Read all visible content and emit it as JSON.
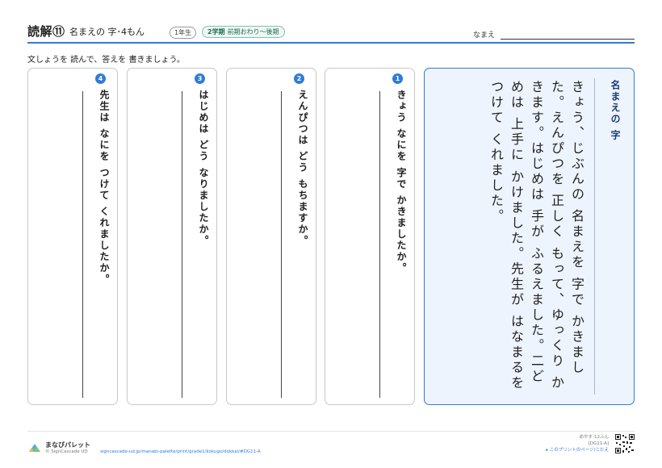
{
  "header": {
    "title": "読解⑪",
    "subtitle": "名まえの 字･4もん",
    "grade_badge": "1年生",
    "term_main": "2学期",
    "term_detail": "前期おわり〜後期",
    "name_label": "なまえ"
  },
  "instruction": "文しょうを 読んで、答えを 書きましょう。",
  "story": {
    "title": "名まえの 字",
    "body": "きょう、じぶんの 名まえを 字で かきました。えんぴつを 正しく もって、ゆっくり かきます。はじめは 手が ふるえました。二どめは 上手に かけました。先生が はなまるを つけて くれました。"
  },
  "questions": [
    {
      "number": "1",
      "text": "きょう なにを 字で かきましたか。"
    },
    {
      "number": "2",
      "text": "えんぴつは どう もちますか。"
    },
    {
      "number": "3",
      "text": "はじめは どう なりましたか。"
    },
    {
      "number": "4",
      "text": "先生は なにを つけて くれましたか。"
    }
  ],
  "footer": {
    "brand": "まなびパレット",
    "copyright": "© SignCascade UD",
    "url": "signcascade-ud.jp/manabi-palette/print/grade1/kokugo/dokkai/#DG11-A",
    "time_estimate": "めやす:12ふん",
    "code": "[DG11-A]",
    "answer_link": "▸ このプリントのページ/こたえ"
  },
  "colors": {
    "accent": "#2f7bd8",
    "story_background": "#eef4fd",
    "term_badge": "#7cc4a8"
  }
}
